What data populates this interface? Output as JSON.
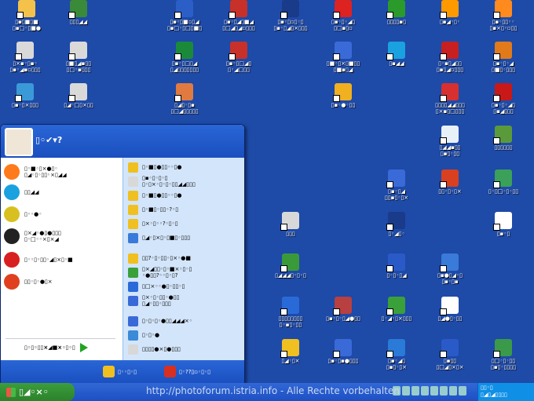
{
  "desktop_icons": [
    {
      "label": "▯▪▯■▯■\n▯▪□◦▯■●",
      "color": "#f4c24a",
      "pos": "a1"
    },
    {
      "label": "▯▯▯◢◢",
      "color": "#3a8a3a",
      "pos": "a2"
    },
    {
      "label": "▯▪◦▯■▫▯◢\n▯▪□◦▯□▯■▯",
      "color": "#2b5fc7",
      "pos": "a3"
    },
    {
      "label": "▯▪◦▯◢▯■◢\n▯□◢▯◢▫▯▯▯",
      "color": "#c8302a",
      "pos": "a4"
    },
    {
      "label": "▯▪◦▯▫▯◦▯\n▯▪◦▯◢▯×▯▯▯",
      "color": "#1a3a8a",
      "pos": "a5"
    },
    {
      "label": "▯▪◦▯◦◢▯\n▯□▪▯▫",
      "color": "#d22",
      "pos": "a6"
    },
    {
      "label": "▯▯▯▯▪▯",
      "color": "#2a9a2a",
      "pos": "a7"
    },
    {
      "label": "▯▪◢◦▯◦",
      "color": "#ff9900",
      "pos": "a8"
    },
    {
      "label": "▯▪◦▯▯◦◦\n▯▪×▯◦▫▯▯",
      "color": "#ff8a1e",
      "pos": "a9"
    },
    {
      "label": "▯×▪◦▯▪◦\n▯▪◦◢▪▫▯▯▯",
      "color": "#d9d9d9",
      "pos": "b1"
    },
    {
      "label": "▯■▯◢▪▯▯\n▯□◦▪▯▯▯",
      "color": "#d9d9d9",
      "pos": "b2"
    },
    {
      "label": "▯▪◦▯□▯◢\n▯◢▯▯▯▯▯▯▯",
      "color": "#1a8a3a",
      "pos": "b3"
    },
    {
      "label": "▯▪◦▯□◢▯\n▯◦◢□▯▯",
      "color": "#c8302a",
      "pos": "b4"
    },
    {
      "label": "▯■◦▯×▯■▯▯\n▯■▪▯◢",
      "color": "#3a6ad8",
      "pos": "b5"
    },
    {
      "label": "▯▪◢◢",
      "color": "#1aa1e0",
      "pos": "b6"
    },
    {
      "label": "▯◦▪▯◢▯▯\n▯▪▯◢▫▯▯▯",
      "color": "#c82020",
      "pos": "b7"
    },
    {
      "label": "▯▪◦▯◦◢\n▯■▯◦▯▯▯",
      "color": "#e07a1a",
      "pos": "b8"
    },
    {
      "label": "▯▪◦▯×▯▯▯",
      "color": "#3a9ad8",
      "pos": "c1"
    },
    {
      "label": "▯◢◦□▯×▯▯",
      "color": "#d9d9d9",
      "pos": "c2"
    },
    {
      "label": "▯◢▯◦▯▪\n▯□◢▯▯▯▯▯",
      "color": "#e07a40",
      "pos": "c3"
    },
    {
      "label": "▯▪◦●◦▯▯",
      "color": "#f0b020",
      "pos": "c4"
    },
    {
      "label": "▯▯▯▯◢◢▯▯▯\n▯×▪▯□▯▯▯",
      "color": "#d83030",
      "pos": "c5"
    },
    {
      "label": "▯▪◦▯◦◢▯\n▯▪◢▯▯▯",
      "color": "#c81818",
      "pos": "c6"
    },
    {
      "label": "▯◢◢▪▯▯\n▯▪▯◦▯▯",
      "color": "#e8f0f8",
      "pos": "d1"
    },
    {
      "label": "▯▯▯▯▯▯",
      "color": "#5a9a3a",
      "pos": "d2"
    },
    {
      "label": "▯▪◦▯◢\n▯▯▪▯◦▯×",
      "color": "#3a6ad8",
      "pos": "e1"
    },
    {
      "label": "▯▯◦▯◦▯×",
      "color": "#d84020",
      "pos": "e2"
    },
    {
      "label": "▯◦▯□◦▯◦▯▯",
      "color": "#3aa05a",
      "pos": "e3"
    },
    {
      "label": "▯▯▯",
      "color": "#d8d8d8",
      "pos": "f1"
    },
    {
      "label": "▯▪◢▯▯▯▯▯▯",
      "color": "#d8d8d8",
      "pos": "f2"
    },
    {
      "label": "▯◦◢▯◦",
      "color": "#1a3a8a",
      "pos": "f3"
    },
    {
      "label": "▯▪◦▯",
      "color": "#fff",
      "pos": "f4"
    },
    {
      "label": "▯◢◢◢▯◦▯◦▯",
      "color": "#3a9a3a",
      "pos": "g1"
    },
    {
      "label": "▯◦▯◦▯◢",
      "color": "#2a5ac8",
      "pos": "g2"
    },
    {
      "label": "▯▪●▯◢◦▯\n▯▪◦▯▪",
      "color": "#3a7ad8",
      "pos": "g3"
    },
    {
      "label": "▯▯▯▯▯▯▯▯\n▯◦▪▯◦▯▯",
      "color": "#2a6ad8",
      "pos": "h1"
    },
    {
      "label": "▯▪◦▯◦▯◢●▯▯",
      "color": "#b84040",
      "pos": "h2"
    },
    {
      "label": "▯◦◢◦▯×▯▯▯",
      "color": "#3aa03a",
      "pos": "h3"
    },
    {
      "label": "▯◢●▯◦▯▯",
      "color": "#fff",
      "pos": "h4"
    },
    {
      "label": "▯◢◦▯×",
      "color": "#f0c020",
      "pos": "i1"
    },
    {
      "label": "▯▪◦▯▪●▯▯▯",
      "color": "#3a6ad8",
      "pos": "i2"
    },
    {
      "label": "▯▪◦◢▯\n▯▪▯◦▯×",
      "color": "#2a7ad8",
      "pos": "i3"
    },
    {
      "label": "▯▪▯▯\n▯□◢▯×▯×",
      "color": "#2a5ac8",
      "pos": "i4"
    },
    {
      "label": "▯□◦▯◦▯▯\n▯▪▯◦▯▯▯▯",
      "color": "#3a9a4a",
      "pos": "i5"
    }
  ],
  "start_menu": {
    "user_name": "▯◦✔▾?",
    "pinned": [
      {
        "label": "▯◦■◦▯×●▯◦\n▯◢◦▯◦▯▯◦×▯◢◢",
        "color": "#ff7a1a"
      },
      {
        "label": "▯▯◢◢",
        "color": "#1aa1e0"
      },
      {
        "label": "▯◦◦●◦",
        "color": "#d8c020"
      },
      {
        "label": "▯×◢◦●▯●▯▯▯\n▯◦□◦◦×▯×◢",
        "color": "#222"
      },
      {
        "label": "▯◦◦▯◦▯▯◦◢▯×▯◦■",
        "color": "#d82020"
      },
      {
        "label": "▯▯◦▯◦●▯×",
        "color": "#e04020"
      }
    ],
    "all_programs": "▯◦▯◦▯▯×◢■×◦▯◦▯",
    "right_items": [
      {
        "label": "▯◦■▯●▯▯◦◦▯●",
        "color": "#f0c020"
      },
      {
        "label": "▯▪◦▯◦▯◦▯\n▯◦▯×◦▯◦▯◦▯▯◢◢▯▯▯",
        "color": "#d8d8d8"
      },
      {
        "label": "▯◦■▯●▯▯◦◦▯●",
        "color": "#f0c020"
      },
      {
        "label": "▯◦■▯◦▯▯◦?◦▯",
        "color": "#f0c020"
      },
      {
        "label": "▯×◦▯◦◦?◦▯◦▯",
        "color": "#f0c020"
      },
      {
        "label": "▯◢◦▯×▯◦▯■▯◦▯▯▯",
        "color": "#3a7ad8"
      },
      {
        "label": "▯▯?◦▯◦▯▯◦▯×◦●■",
        "color": "#f0c020"
      },
      {
        "label": "▯×◢▯▯◦▯◦■×◦▯◦▯\n◦●▯▯?◦◦▯◦▯?",
        "color": "#3aa03a"
      },
      {
        "label": "▯□×◦◦●▯◦▯▯◦▯",
        "color": "#2a6ad8"
      },
      {
        "label": "▯×◦▯◦▯▯◦●▯▯\n▯◢◦▯▯◦▯▯▯",
        "color": "#3a6ad8"
      },
      {
        "label": "▯◦▯◦▯◦●▯▯◢◢◢×◦",
        "color": "#3a6ad8"
      },
      {
        "label": "▯◦▯◦●",
        "color": "#3a8ad8"
      },
      {
        "label": "▯▯▯▯●×▯●▯▯▯",
        "color": "#d8d8d8"
      }
    ],
    "logoff": "▯◦◦▯◦▯",
    "shutdown": "▯◦??▯▫◦▯◦▯"
  },
  "taskbar": {
    "start_label": "▯◢◦×◦",
    "watermark": "http://photoforum.istria.info - Alle Rechte vorbehalten",
    "clock_line1": "▯▯◦▯",
    "clock_line2": "▯◢▯◢▯▯▯▯"
  }
}
